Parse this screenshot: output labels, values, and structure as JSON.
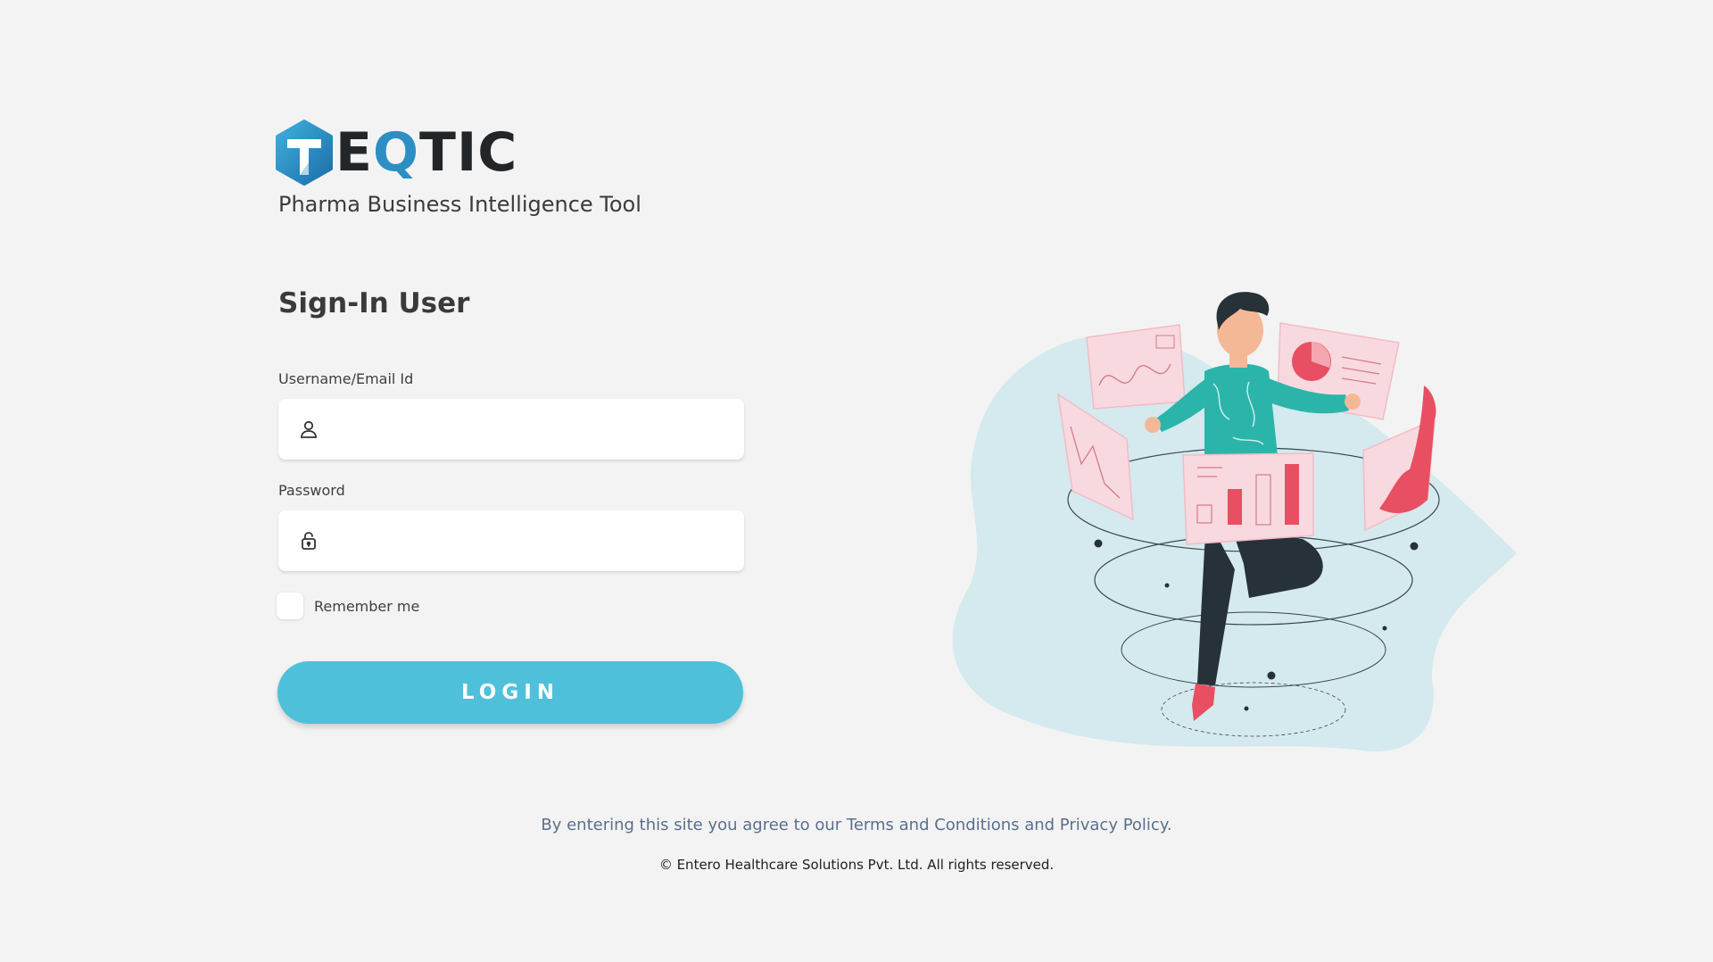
{
  "brand": {
    "logo_text_before": "E",
    "logo_text_q": "Q",
    "logo_text_after": "TIC",
    "tagline": "Pharma Business Intelligence Tool",
    "colors": {
      "hex_dark": "#1b6ea8",
      "hex_light": "#3fb0dd",
      "wordmark": "#232629",
      "q_accent": "#2c8fc3",
      "q_tail": "#f0a43a"
    }
  },
  "form": {
    "title": "Sign-In User",
    "username": {
      "label": "Username/Email Id",
      "value": "",
      "placeholder": "",
      "icon": "user-icon"
    },
    "password": {
      "label": "Password",
      "value": "",
      "placeholder": "",
      "icon": "lock-icon"
    },
    "remember": {
      "label": "Remember me",
      "checked": false
    },
    "login_label": "LOGIN",
    "login_color": "#4ec0da"
  },
  "illustration": {
    "icon": "analytics-person-illustration",
    "blob_color": "#d4eaee",
    "panel_color": "#f8d9df",
    "accent_color": "#e84f62",
    "shirt_color": "#2bb5aa"
  },
  "footer": {
    "agreement": "By entering this site you agree to our Terms and Conditions and Privacy Policy.",
    "copyright": "© Entero Healthcare Solutions Pvt. Ltd. All rights reserved."
  },
  "background_color": "#f3f3f3"
}
